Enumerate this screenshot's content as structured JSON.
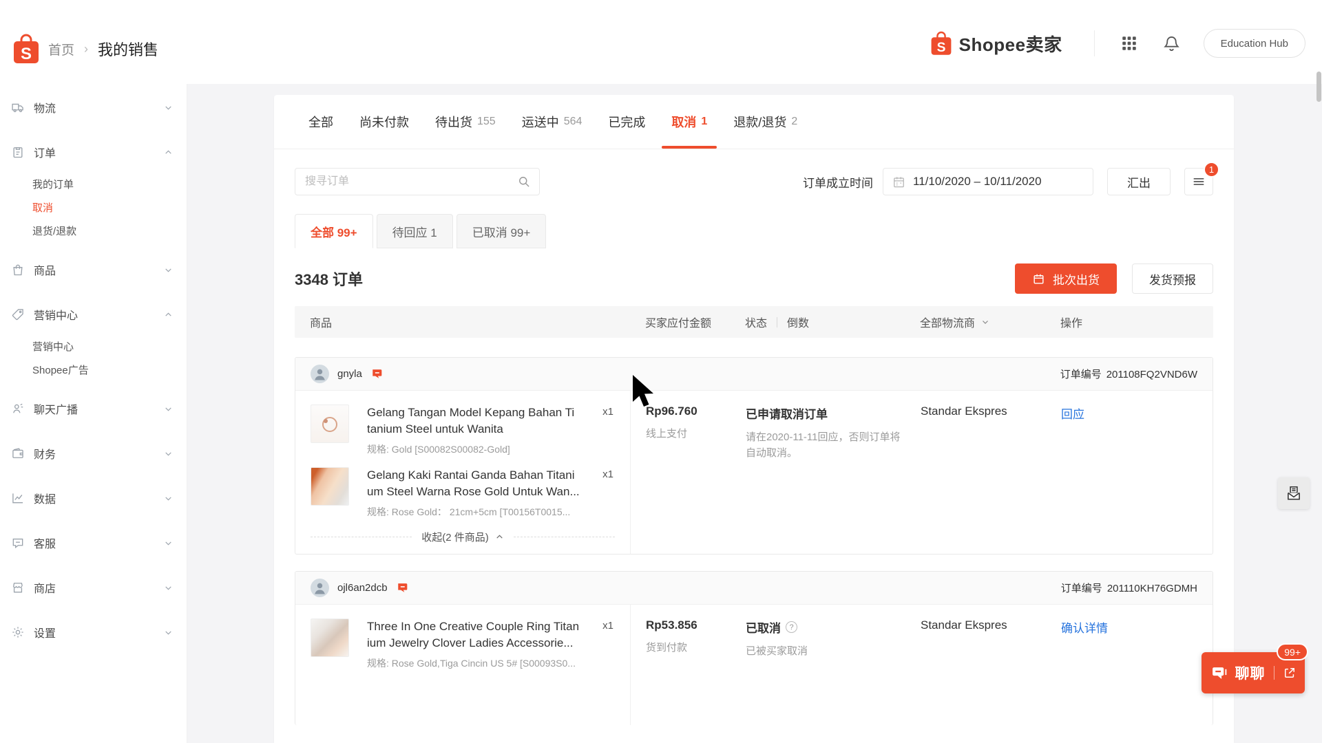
{
  "colors": {
    "accent": "#ee4d2d",
    "link": "#2673dd"
  },
  "header": {
    "breadcrumb_home": "首页",
    "breadcrumb_sep": "›",
    "breadcrumb_current": "我的销售",
    "brand": "Shopee卖家",
    "education_hub": "Education Hub"
  },
  "sidebar": {
    "items": [
      {
        "icon": "truck-icon",
        "label": "物流"
      },
      {
        "icon": "clipboard-icon",
        "label": "订单",
        "children": [
          {
            "label": "我的订单"
          },
          {
            "label": "取消",
            "active": true
          },
          {
            "label": "退货/退款"
          }
        ]
      },
      {
        "icon": "bag-icon",
        "label": "商品"
      },
      {
        "icon": "tag-icon",
        "label": "营销中心",
        "children": [
          {
            "label": "营销中心"
          },
          {
            "label": "Shopee广告"
          }
        ]
      },
      {
        "icon": "person-icon",
        "label": "聊天广播"
      },
      {
        "icon": "wallet-icon",
        "label": "财务"
      },
      {
        "icon": "chart-icon",
        "label": "数据"
      },
      {
        "icon": "chat-bubble-icon",
        "label": "客服"
      },
      {
        "icon": "shop-icon",
        "label": "商店"
      },
      {
        "icon": "gear-icon",
        "label": "设置"
      }
    ]
  },
  "tabs": [
    {
      "label": "全部",
      "count": ""
    },
    {
      "label": "尚未付款",
      "count": ""
    },
    {
      "label": "待出货",
      "count": "155"
    },
    {
      "label": "运送中",
      "count": "564"
    },
    {
      "label": "已完成",
      "count": ""
    },
    {
      "label": "取消",
      "count": "1",
      "active": true
    },
    {
      "label": "退款/退货",
      "count": "2"
    }
  ],
  "filters": {
    "search_placeholder": "搜寻订单",
    "date_label": "订单成立时间",
    "date_range": "11/10/2020 – 10/11/2020",
    "export_label": "汇出",
    "menu_badge": "1"
  },
  "subtabs": [
    {
      "label": "全部 99+",
      "active": true
    },
    {
      "label": "待回应 1"
    },
    {
      "label": "已取消 99+"
    }
  ],
  "summary": {
    "orders_count": "3348 订单",
    "batch_ship": "批次出货",
    "shipping_forecast": "发货预报"
  },
  "table": {
    "col_product": "商品",
    "col_amount": "买家应付金额",
    "col_status": "状态",
    "col_countdown": "倒数",
    "col_logistics": "全部物流商",
    "col_action": "操作"
  },
  "orders": [
    {
      "buyer": "gnyla",
      "order_label": "订单编号",
      "order_no": "201108FQ2VND6W",
      "products": [
        {
          "title1": "Gelang Tangan Model Kepang Bahan Ti",
          "title2": "tanium Steel untuk Wanita",
          "qty": "x1",
          "spec": "规格: Gold [S00082S00082-Gold]"
        },
        {
          "title1": "Gelang Kaki Rantai Ganda Bahan Titani",
          "title2": "um Steel Warna Rose Gold Untuk Wan...",
          "qty": "x1",
          "spec": "规格: Rose Gold： 21cm+5cm [T00156T0015..."
        }
      ],
      "collapse": "收起(2 件商品)",
      "amount": "Rp96.760",
      "payment": "线上支付",
      "status": "已申请取消订单",
      "note": "请在2020-11-11回应，否则订单将自动取消。",
      "logistics": "Standar Ekspres",
      "action": "回应"
    },
    {
      "buyer": "ojl6an2dcb",
      "order_label": "订单编号",
      "order_no": "201110KH76GDMH",
      "products": [
        {
          "title1": "Three In One Creative Couple Ring Titan",
          "title2": "ium Jewelry Clover Ladies Accessorie...",
          "qty": "x1",
          "spec": "规格: Rose Gold,Tiga Cincin US 5# [S00093S0..."
        }
      ],
      "amount": "Rp53.856",
      "payment": "货到付款",
      "status": "已取消",
      "help": "?",
      "note": "已被买家取消",
      "logistics": "Standar Ekspres",
      "action": "确认详情"
    }
  ],
  "floating": {
    "chat_label": "聊聊",
    "chat_badge": "99+"
  }
}
